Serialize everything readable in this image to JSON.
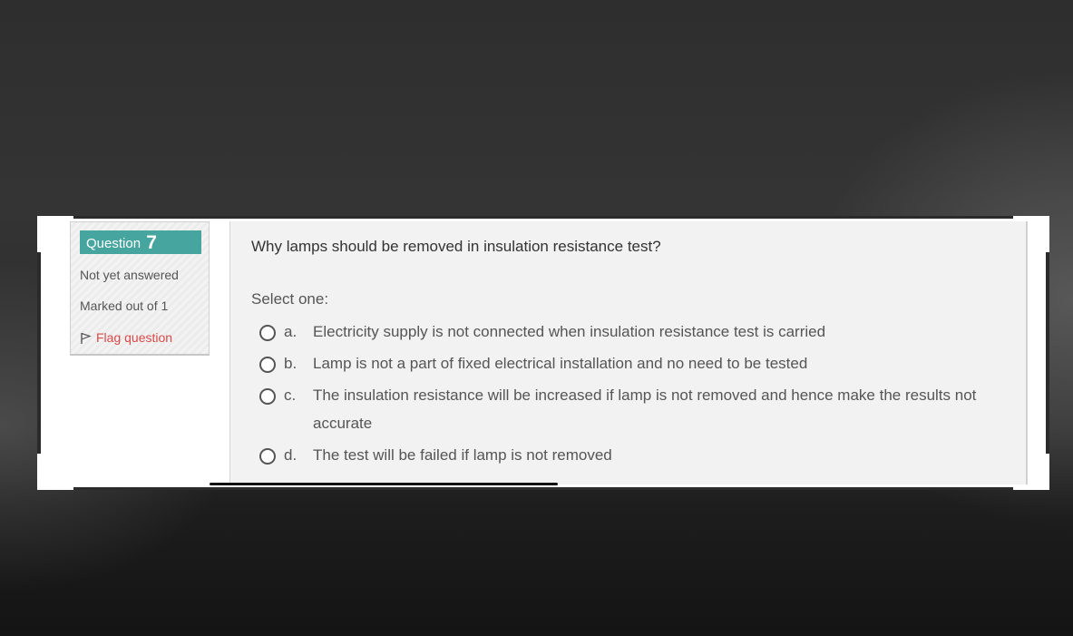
{
  "question_info": {
    "label": "Question",
    "number": "7",
    "state": "Not yet answered",
    "grade": "Marked out of 1",
    "flag_label": "Flag question"
  },
  "question": {
    "text": "Why lamps should be removed in insulation resistance test?",
    "prompt": "Select one:",
    "options": [
      {
        "letter": "a.",
        "text": "Electricity supply is not connected when insulation resistance test is carried"
      },
      {
        "letter": "b.",
        "text": "Lamp is not a part of fixed electrical installation and no need to be tested"
      },
      {
        "letter": "c.",
        "text": "The insulation resistance will be increased if lamp is not removed and hence make the results not accurate"
      },
      {
        "letter": "d.",
        "text": "The test will be failed if lamp is not removed"
      }
    ]
  },
  "colors": {
    "question_badge": "#47a59f",
    "flag_link": "#d94a4a",
    "panel_bg": "#f2f2f2"
  },
  "icons": {
    "flag": "flag-icon",
    "radio": "radio-unchecked"
  }
}
